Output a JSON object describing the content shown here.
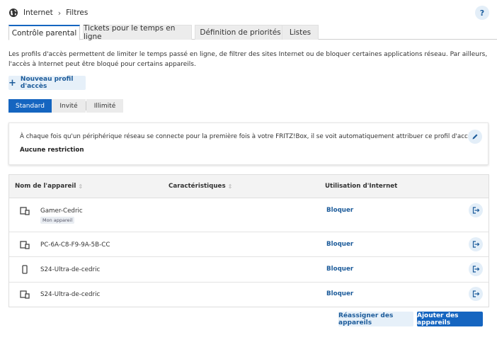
{
  "breadcrumb": {
    "section": "Internet",
    "page": "Filtres"
  },
  "help_label": "?",
  "tabs": [
    {
      "label": "Contrôle parental"
    },
    {
      "label": "Tickets pour le temps en ligne"
    },
    {
      "label": "Définition de priorités"
    },
    {
      "label": "Listes"
    }
  ],
  "intro": "Les profils d'accès permettent de limiter le temps passé en ligne, de filtrer des sites Internet ou de bloquer certaines applications réseau. Par ailleurs, l'accès à Internet peut être bloqué pour certains appareils.",
  "new_profile_label": "Nouveau profil d'accès",
  "profiles": [
    {
      "label": "Standard"
    },
    {
      "label": "Invité"
    },
    {
      "label": "Illimité"
    }
  ],
  "card": {
    "text": "À chaque fois qu'un périphérique réseau se connecte pour la première fois à votre FRITZ!Box, il se voit automatiquement attribuer ce profil d'accès.",
    "restriction": "Aucune restriction"
  },
  "table": {
    "headers": {
      "name": "Nom de l'appareil",
      "characteristics": "Caractéristiques",
      "usage": "Utilisation d'Internet"
    },
    "rows": [
      {
        "name": "Gamer-Cedric",
        "badge": "Mon appareil",
        "action": "Bloquer",
        "icon": "computer-icon"
      },
      {
        "name": "PC-6A-C8-F9-9A-5B-CC",
        "action": "Bloquer",
        "icon": "computer-icon"
      },
      {
        "name": "S24-Ultra-de-cedric",
        "action": "Bloquer",
        "icon": "smartphone-icon"
      },
      {
        "name": "S24-Ultra-de-cedric",
        "action": "Bloquer",
        "icon": "computer-icon"
      }
    ]
  },
  "buttons": {
    "reassign": "Réassigner des appareils",
    "add": "Ajouter des appareils"
  },
  "colors": {
    "accent": "#1565c0",
    "link": "#1c5b9a",
    "light_button": "#e6f0f9"
  }
}
